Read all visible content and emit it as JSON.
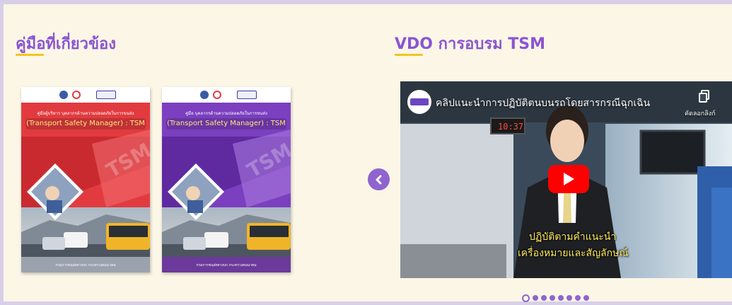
{
  "manuals_section": {
    "title": "คู่มือที่เกี่ยวข้อง",
    "cards": [
      {
        "subtitle": "คู่มือผู้บริหาร บุคลากรด้านความปลอดภัยในการขนส่ง",
        "title": "(Transport Safety Manager) : TSM",
        "footer": "กรมการขนส่งทางบก กระทรวงคมนาคม",
        "theme_color": "#e03a3e"
      },
      {
        "subtitle": "คู่มือ บุคลากรด้านความปลอดภัยในการขนส่ง",
        "title": "(Transport Safety Manager) : TSM",
        "footer": "กรมการขนส่งทางบก กระทรวงคมนาคม",
        "theme_color": "#7b3fbf"
      }
    ]
  },
  "video_section": {
    "title": "VDO การอบรม TSM",
    "video": {
      "title": "คลิปแนะนำการปฏิบัติตนบนรถโดยสารกรณีฉุกเฉิน",
      "copy_link_label": "คัดลอกลิงก์",
      "clock": "10:37",
      "caption_line1": "ปฏิบัติตามคำแนะนำ",
      "caption_line2": "เครื่องหมายและสัญลักษณ์"
    },
    "carousel": {
      "total_dots": 8,
      "active_index": 0
    }
  },
  "colors": {
    "accent": "#8b55d1",
    "underline": "#f3c520",
    "background": "#fbf6e6",
    "youtube_red": "#ff0000"
  }
}
